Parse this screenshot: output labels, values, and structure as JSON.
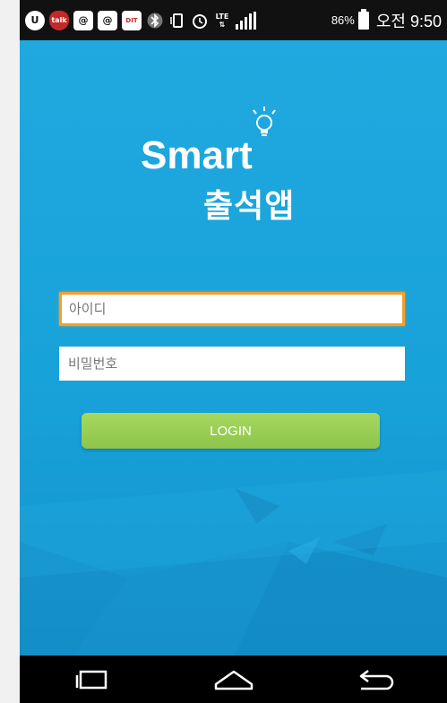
{
  "status_bar": {
    "icons": [
      "u-plus-icon",
      "talk-shield-icon",
      "at-icon",
      "at-icon",
      "dit-app-icon",
      "bluetooth-icon",
      "vibrate-icon",
      "alarm-icon",
      "lte-icon",
      "signal-icon",
      "battery-icon"
    ],
    "talk_label": "talk",
    "at_label": "@",
    "dit_label": "DIT",
    "lte_label": "LTE",
    "battery_percent": "86%",
    "time": "오전 9:50"
  },
  "logo": {
    "line1": "Smart",
    "line2": "출석앱"
  },
  "form": {
    "id_placeholder": "아이디",
    "id_value": "",
    "password_placeholder": "비밀번호",
    "password_value": "",
    "login_label": "LOGIN"
  },
  "colors": {
    "background": "#1fa9df",
    "login_button": "#9ccf55",
    "focus_border": "#f0a030"
  },
  "nav_bar": {
    "buttons": [
      "recent-apps-icon",
      "home-icon",
      "back-icon"
    ]
  }
}
